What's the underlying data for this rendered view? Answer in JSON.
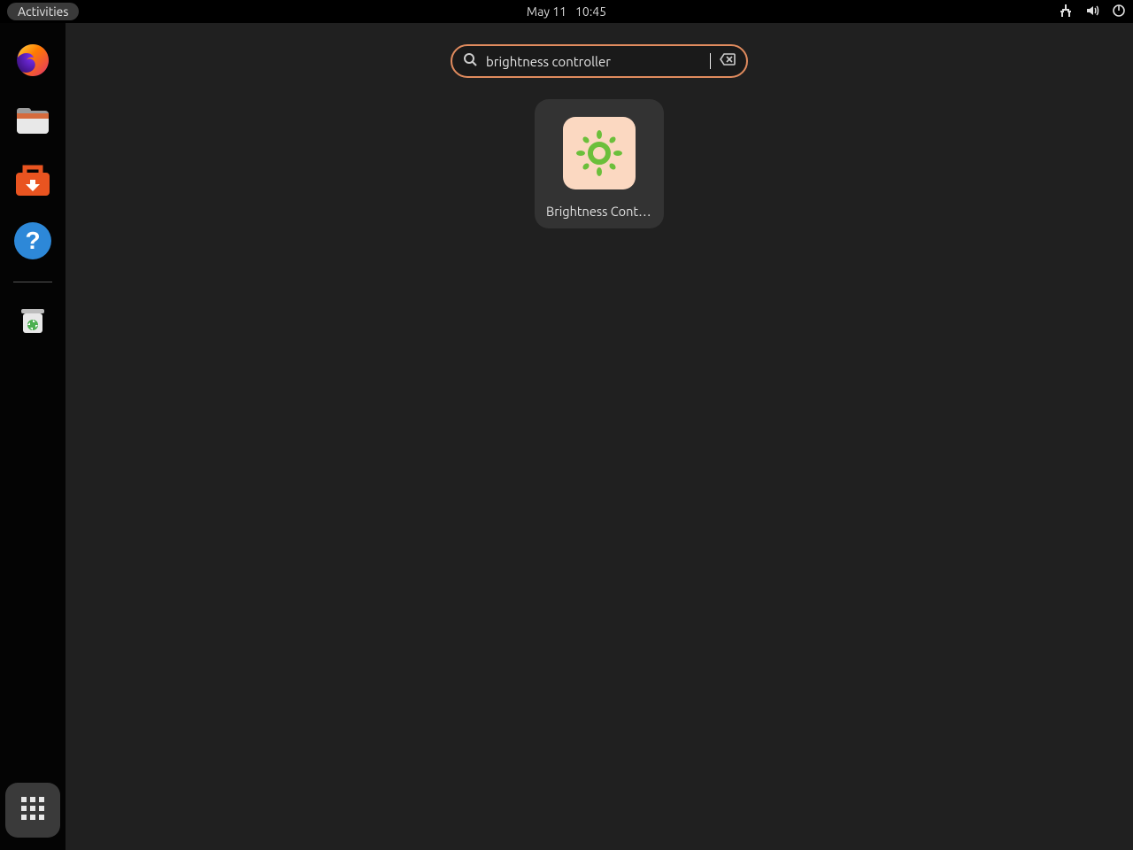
{
  "topbar": {
    "activities_label": "Activities",
    "date": "May 11",
    "time": "10:45"
  },
  "dock": {
    "items": [
      {
        "name": "firefox"
      },
      {
        "name": "files"
      },
      {
        "name": "software"
      },
      {
        "name": "help"
      }
    ],
    "trash": {
      "name": "trash"
    },
    "show_apps": {
      "name": "show-applications"
    }
  },
  "search": {
    "value": "brightness controller",
    "placeholder": ""
  },
  "results": [
    {
      "label": "Brightness Controller",
      "icon": "brightness"
    }
  ]
}
